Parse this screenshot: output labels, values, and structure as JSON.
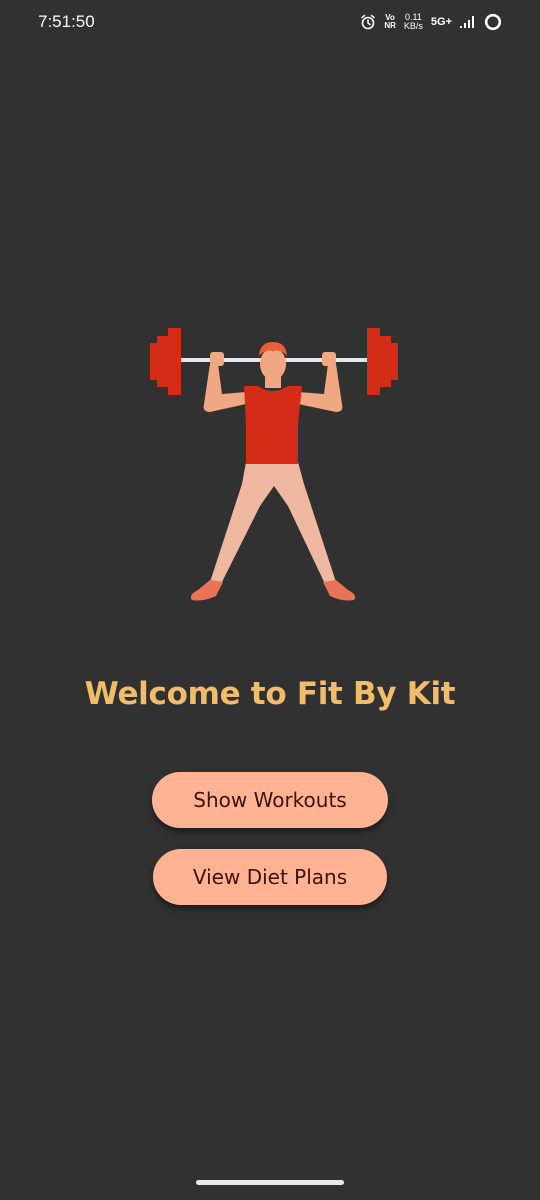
{
  "status_bar": {
    "time": "7:51:50",
    "volte_top": "Vo",
    "volte_bottom": "NR",
    "net_speed_value": "0.11",
    "net_speed_unit": "KB/s",
    "network_type": "5G+",
    "icons": [
      "alarm-icon",
      "volte-icon",
      "network-speed-indicator",
      "signal-icon",
      "data-saver-icon"
    ]
  },
  "illustration": {
    "semantic": "weightlifter-with-barbell",
    "colors": {
      "weights": "#d42b16",
      "bar": "#e6e6f0",
      "skin": "#f0a882",
      "hair": "#e8603a",
      "tank_top": "#d42b16",
      "pants": "#f0b7a1",
      "shoes": "#e87356"
    }
  },
  "main": {
    "title": "Welcome to Fit By Kit",
    "buttons": {
      "workouts": "Show Workouts",
      "diet": "View Diet Plans"
    }
  },
  "colors": {
    "background": "#313131",
    "title": "#f2bd6b",
    "button_bg": "#ffb393",
    "button_text": "#3a1208"
  }
}
